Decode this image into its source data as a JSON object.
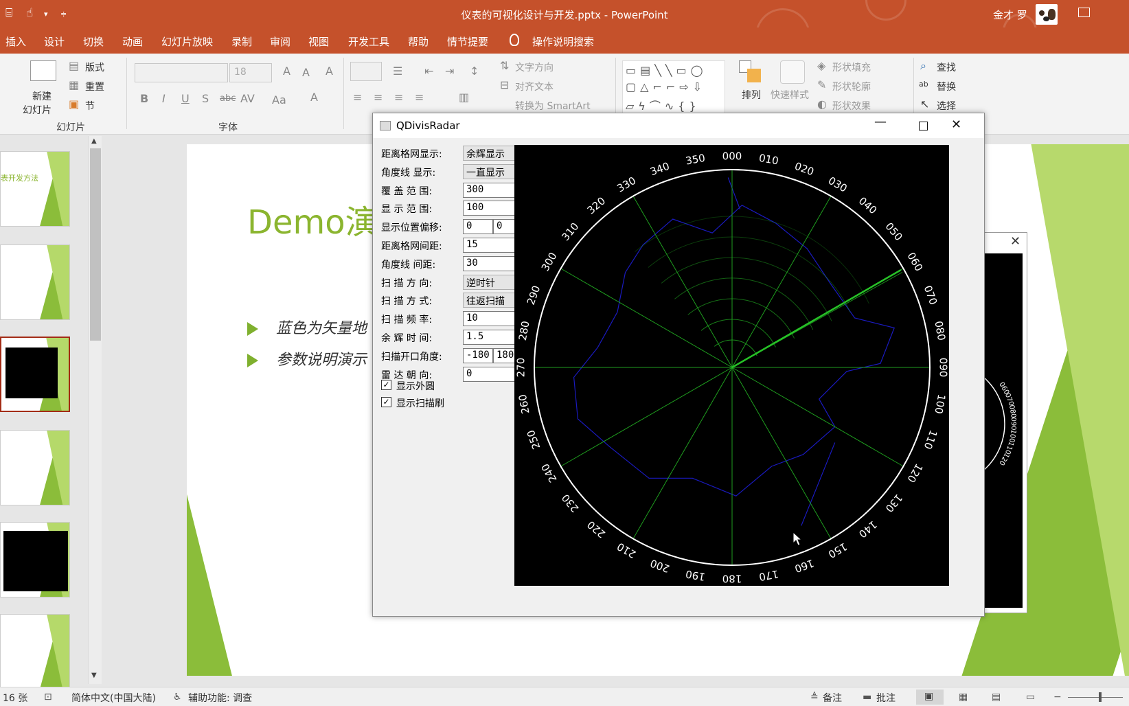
{
  "app": {
    "doc_title": "仪表的可视化设计与开发.pptx  -  PowerPoint",
    "user_name": "金才 罗"
  },
  "menu": [
    "插入",
    "设计",
    "切换",
    "动画",
    "幻灯片放映",
    "录制",
    "审阅",
    "视图",
    "开发工具",
    "帮助",
    "情节提要"
  ],
  "menu_search": "操作说明搜索",
  "ribbon": {
    "new_slide_line1": "新建",
    "new_slide_line2": "幻灯片",
    "layout": "版式",
    "reset": "重置",
    "section": "节",
    "group_slides": "幻灯片",
    "font_size": "18",
    "group_font": "字体",
    "text_direction": "文字方向",
    "align_text": "对齐文本",
    "convert_smartart": "转换为 SmartArt",
    "arrange": "排列",
    "quick_styles": "快速样式",
    "shape_fill": "形状填充",
    "shape_outline": "形状轮廓",
    "shape_effects": "形状效果",
    "find": "查找",
    "replace": "替换",
    "select": "选择"
  },
  "slide": {
    "title": "Demo演",
    "bullets": [
      "蓝色为矢量地",
      "参数说明演示"
    ]
  },
  "qt_window": {
    "title": "QDivisRadar",
    "rows": [
      {
        "label": "距离格网显示:",
        "type": "select",
        "value": "余辉显示"
      },
      {
        "label": "角度线 显示:",
        "type": "select",
        "value": "一直显示"
      },
      {
        "label": "覆 盖 范 围:",
        "type": "input",
        "value": "300"
      },
      {
        "label": "显 示 范 围:",
        "type": "input",
        "value": "100"
      },
      {
        "label": "显示位置偏移:",
        "type": "pair",
        "value": "0",
        "value2": "0"
      },
      {
        "label": "距离格网间距:",
        "type": "input",
        "value": "15"
      },
      {
        "label": "角度线 间距:",
        "type": "input",
        "value": "30"
      },
      {
        "label": "扫 描 方 向:",
        "type": "select",
        "value": "逆时针"
      },
      {
        "label": "扫 描 方 式:",
        "type": "select",
        "value": "往返扫描"
      },
      {
        "label": "扫 描 频 率:",
        "type": "input",
        "value": "10"
      },
      {
        "label": "余 辉 时 间:",
        "type": "input",
        "value": "1.5"
      },
      {
        "label": "扫描开口角度:",
        "type": "pair",
        "value": "-180",
        "value2": "180"
      },
      {
        "label": "雷 达 朝 向:",
        "type": "input",
        "value": "0"
      }
    ],
    "show_outer_circle": "显示外圆",
    "show_scan_brush": "显示扫描刷",
    "angle_labels": [
      "000",
      "010",
      "020",
      "030",
      "040",
      "050",
      "060",
      "070",
      "080",
      "090",
      "100",
      "110",
      "120",
      "130",
      "140",
      "150",
      "160",
      "170",
      "180",
      "190",
      "200",
      "210",
      "220",
      "230",
      "240",
      "250",
      "260",
      "270",
      "280",
      "290",
      "300",
      "310",
      "320",
      "330",
      "340",
      "350"
    ],
    "sweep_angle_deg": 60,
    "colors": {
      "grid": "#1f9e1f",
      "sweep": "#27c227",
      "map": "#1a1abf",
      "ring": "#ffffff"
    }
  },
  "bg_window_labels": [
    "060",
    "070",
    "080",
    "090",
    "100",
    "110",
    "120"
  ],
  "status": {
    "slides": "16 张",
    "language": "简体中文(中国大陆)",
    "accessibility": "辅助功能: 调查",
    "notes": "备注",
    "comments": "批注"
  }
}
